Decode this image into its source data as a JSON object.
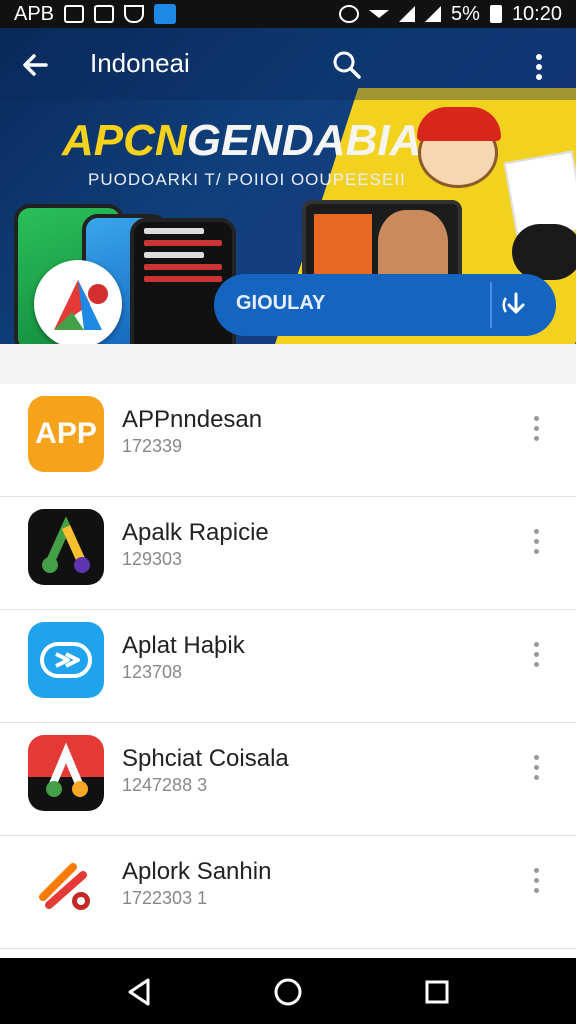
{
  "status_bar": {
    "left_text": "APB",
    "right_text": "5%",
    "time": "10:20"
  },
  "appbar": {
    "title": "Indoneai"
  },
  "banner": {
    "headline_prefix": "APCN",
    "headline_rest": "GENDABIA",
    "subline": "PUODOARKI T/ POIIOI OOUPEESEII",
    "download_label": "GIOULAY"
  },
  "apps": [
    {
      "name": "APPnndesan",
      "meta": "172339",
      "icon_label": "APP"
    },
    {
      "name": "Apalk Rapicie",
      "meta": "129303",
      "icon_label": ""
    },
    {
      "name": "Aplat Haþik",
      "meta": "123708",
      "icon_label": ""
    },
    {
      "name": "Sphciat Coisala",
      "meta": "1247288 3",
      "icon_label": ""
    },
    {
      "name": "Aplork Sanhin",
      "meta": "1722303 1",
      "icon_label": ""
    }
  ],
  "colors": {
    "accent_yellow": "#f7d21a",
    "primary_blue": "#1565c0"
  }
}
